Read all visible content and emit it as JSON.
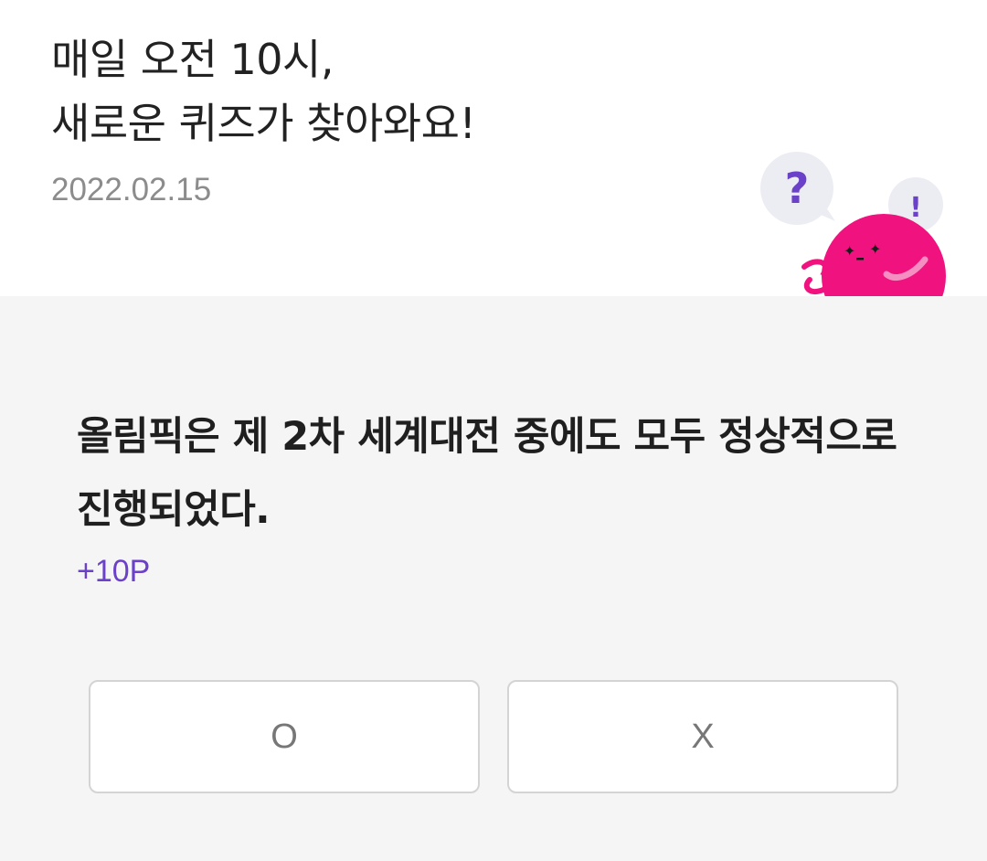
{
  "header": {
    "title_line1": "매일 오전 10시,",
    "title_line2": "새로운 퀴즈가 찾아와요!",
    "date": "2022.02.15"
  },
  "mascot": {
    "question_mark": "?",
    "exclamation_mark": "!",
    "accent_color": "#e8127e",
    "icon_color": "#6a41c8"
  },
  "quiz": {
    "question": "올림픽은 제 2차 세계대전 중에도 모두 정상적으로 진행되었다.",
    "points": "+10P",
    "options": [
      "O",
      "X"
    ]
  }
}
